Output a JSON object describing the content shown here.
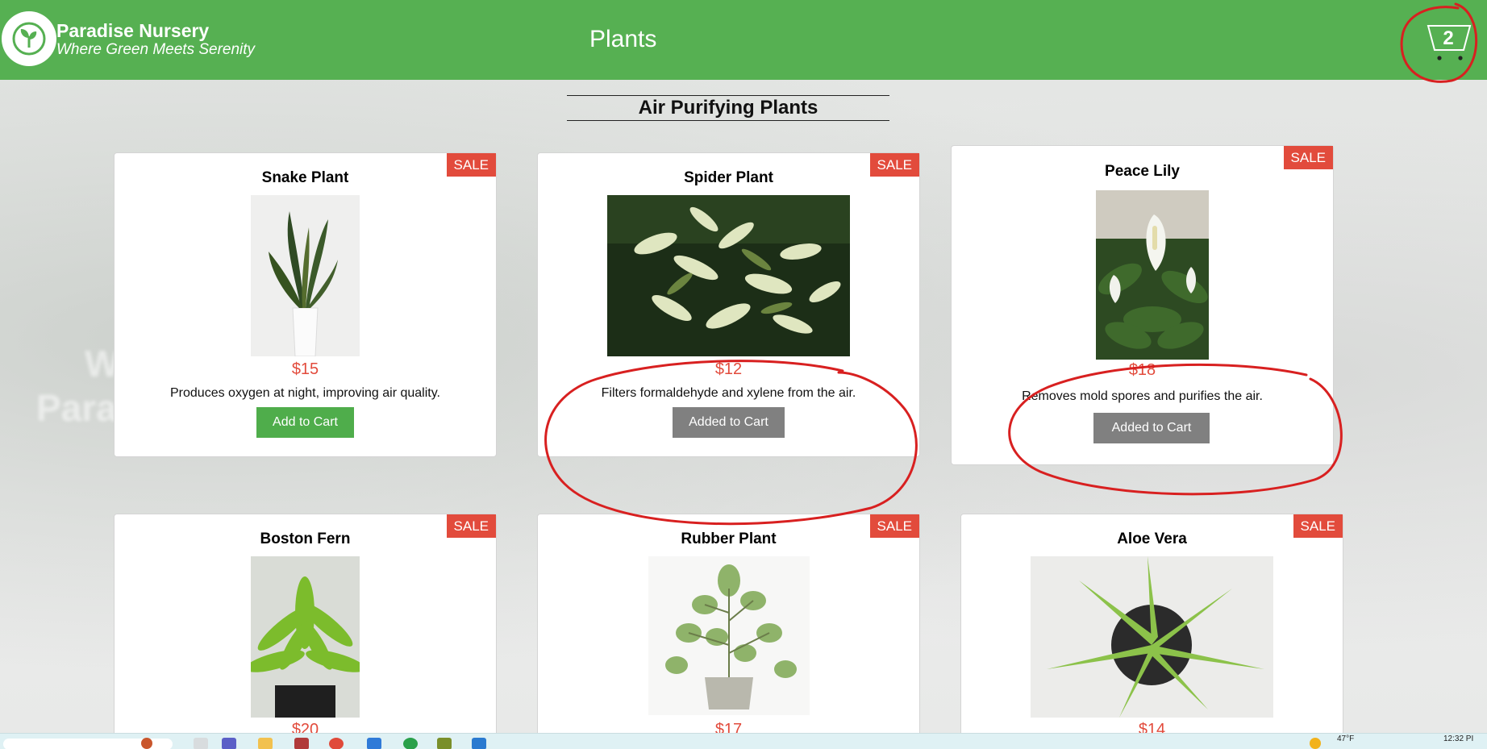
{
  "navbar": {
    "brand_name": "Paradise Nursery",
    "brand_tagline": "Where Green Meets Serenity",
    "nav_link": "Plants",
    "cart_count": "2"
  },
  "section": {
    "title": "Air Purifying Plants"
  },
  "sale_label": "SALE",
  "plants": [
    {
      "name": "Snake Plant",
      "price": "$15",
      "description": "Produces oxygen at night, improving air quality.",
      "button": "Add to Cart",
      "added": false
    },
    {
      "name": "Spider Plant",
      "price": "$12",
      "description": "Filters formaldehyde and xylene from the air.",
      "button": "Added to Cart",
      "added": true
    },
    {
      "name": "Peace Lily",
      "price": "$18",
      "description": "Removes mold spores and purifies the air.",
      "button": "Added to Cart",
      "added": true
    },
    {
      "name": "Boston Fern",
      "price": "$20"
    },
    {
      "name": "Rubber Plant",
      "price": "$17"
    },
    {
      "name": "Aloe Vera",
      "price": "$14"
    }
  ],
  "taskbar": {
    "weather": "47°F",
    "time": "12:32 PI"
  },
  "colors": {
    "brand_green": "#56b052",
    "sale_red": "#e24b3c",
    "added_gray": "#808080",
    "annotation_red": "#d82020"
  }
}
